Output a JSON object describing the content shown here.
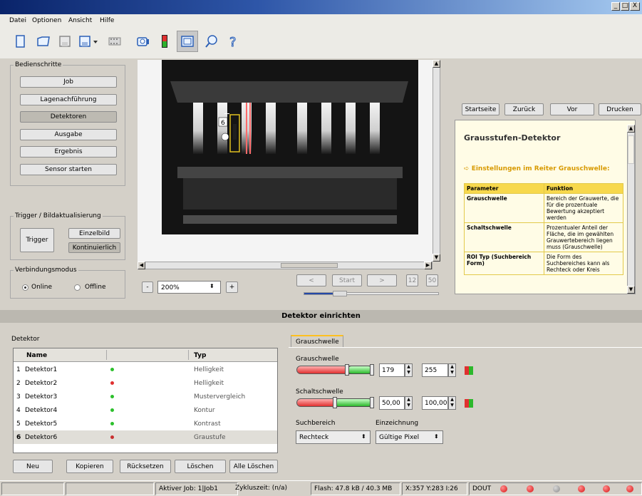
{
  "window": {
    "minimize": "_",
    "maximize": "□",
    "close": "X"
  },
  "menu": [
    "Datei",
    "Optionen",
    "Ansicht",
    "Hilfe"
  ],
  "toolbar": {
    "icons": [
      "new-file-icon",
      "open-folder-icon",
      "save-icon",
      "save-as-icon",
      "dropdown-arrow-icon",
      "film-icon",
      "camera-icon",
      "traffic-light-icon",
      "window-mode-icon",
      "zoom-icon",
      "help-icon"
    ]
  },
  "steps": {
    "title": "Bedienschritte",
    "buttons": [
      "Job",
      "Lagenachführung",
      "Detektoren",
      "Ausgabe",
      "Ergebnis",
      "Sensor starten"
    ],
    "selected": "Detektoren"
  },
  "trigger": {
    "title": "Trigger / Bildaktualisierung",
    "trigger_label": "Trigger",
    "single_label": "Einzelbild",
    "continuous_label": "Kontinuierlich"
  },
  "connection": {
    "title": "Verbindungsmodus",
    "online_label": "Online",
    "offline_label": "Offline",
    "selected": "Online"
  },
  "view": {
    "roi_label": "6",
    "zoom_minus": "-",
    "zoom_value": "200%",
    "zoom_plus": "+",
    "prev": "<",
    "start": "Start",
    "next": ">",
    "count_a": "12",
    "count_b": "50"
  },
  "help": {
    "nav": [
      "Startseite",
      "Zurück",
      "Vor",
      "Drucken"
    ],
    "title": "Grausstufen-Detektor",
    "section": "Einstellungen im Reiter Grauschwelle:",
    "header": [
      "Parameter",
      "Funktion"
    ],
    "rows": [
      {
        "param": "Grauschwelle",
        "func": "Bereich der Grauwerte, die für die prozentuale Bewertung akzeptiert werden"
      },
      {
        "param": "Schaltschwelle",
        "func": "Prozentualer Anteil der Fläche, die im gewählten Grauwertebereich liegen muss (Grauschwelle)"
      },
      {
        "param": "ROI Typ (Suchbereich Form)",
        "func": "Die Form des Suchbereiches kann als Rechteck oder Kreis"
      }
    ]
  },
  "section_title": "Detektor einrichten",
  "detector": {
    "group_label": "Detektor",
    "col_name": "Name",
    "col_type": "Typ",
    "rows": [
      {
        "num": "1",
        "name": "Detektor1",
        "status": "green",
        "type": "Helligkeit"
      },
      {
        "num": "2",
        "name": "Detektor2",
        "status": "red",
        "type": "Helligkeit"
      },
      {
        "num": "3",
        "name": "Detektor3",
        "status": "green",
        "type": "Mustervergleich"
      },
      {
        "num": "4",
        "name": "Detektor4",
        "status": "green",
        "type": "Kontur"
      },
      {
        "num": "5",
        "name": "Detektor5",
        "status": "green",
        "type": "Kontrast"
      },
      {
        "num": "6",
        "name": "Detektor6",
        "status": "red",
        "type": "Graustufe"
      }
    ],
    "buttons": [
      "Neu",
      "Kopieren",
      "Rücksetzen",
      "Löschen",
      "Alle Löschen"
    ]
  },
  "settings": {
    "tab": "Grauschwelle",
    "gray_label": "Grauschwelle",
    "gray_min": "179",
    "gray_max": "255",
    "switch_label": "Schaltschwelle",
    "switch_min": "50,00",
    "switch_max": "100,00",
    "search_label": "Suchbereich",
    "search_value": "Rechteck",
    "draw_label": "Einzeichnung",
    "draw_value": "Gültige Pixel"
  },
  "status": {
    "job": "Aktiver Job:  1|Job1",
    "cycle": "Zykluszeit:  (n/a)",
    "flash": "Flash:  47.8 kB / 40.3 MB",
    "coords": "X:357 Y:283 I:26",
    "dout": "DOUT",
    "leds": [
      "#d81010",
      "#d81010",
      "#9a9a9a",
      "#d81010",
      "#d81010",
      "#d81010"
    ]
  }
}
